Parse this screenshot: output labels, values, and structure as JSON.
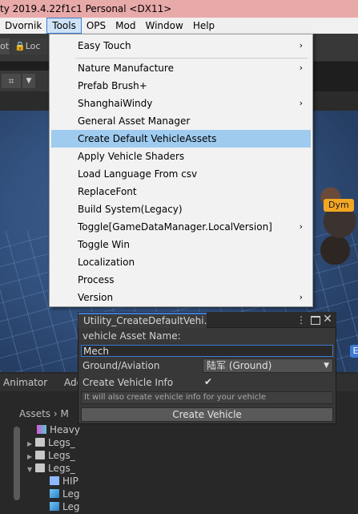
{
  "window": {
    "title": "ty 2019.4.22f1c1 Personal <DX11>"
  },
  "menubar": {
    "items": [
      "Dvornik",
      "Tools",
      "OPS",
      "Mod",
      "Window",
      "Help"
    ],
    "active": "Tools"
  },
  "scene_view": {
    "tab_left": "ot",
    "tab_lock": "Loc",
    "gizmo_icon": "grid-icon",
    "object_label_1": "Dym",
    "object_label_2": "E"
  },
  "tools_menu": {
    "items": [
      {
        "label": "Easy Touch",
        "submenu": true
      },
      {
        "label": "Nature Manufacture",
        "submenu": true
      },
      {
        "label": "Prefab Brush+",
        "submenu": false
      },
      {
        "label": "ShanghaiWindy",
        "submenu": true
      },
      {
        "label": "General Asset Manager",
        "submenu": false
      },
      {
        "label": "Create Default VehicleAssets",
        "submenu": false,
        "highlighted": true
      },
      {
        "label": "Apply Vehicle Shaders",
        "submenu": false
      },
      {
        "label": "Load Language From csv",
        "submenu": false
      },
      {
        "label": "ReplaceFont",
        "submenu": false
      },
      {
        "label": "Build System(Legacy)",
        "submenu": false
      },
      {
        "label": "Toggle[GameDataManager.LocalVersion]",
        "submenu": true
      },
      {
        "label": "Toggle Win",
        "submenu": false
      },
      {
        "label": "Localization",
        "submenu": false
      },
      {
        "label": "Process",
        "submenu": false
      },
      {
        "label": "Version",
        "submenu": true
      }
    ],
    "submenu_glyph": "›"
  },
  "utility_window": {
    "tab_title": "Utility_CreateDefaultVehi...",
    "asset_name_label": "vehicle Asset Name:",
    "asset_name_value": "Mech",
    "ground_label": "Ground/Aviation",
    "ground_value": "陆军 (Ground)",
    "create_info_label": "Create Vehicle Info",
    "create_info_checked": true,
    "check_glyph": "✔",
    "help_text": "It will also create vehicle info for your vehicle",
    "create_button": "Create Vehicle",
    "kebab_glyph": "⋮",
    "close_glyph": "✕"
  },
  "bottom_panel": {
    "tab_animator": "Animator",
    "tab_add": "Add",
    "breadcrumb": "Assets › M",
    "tree": [
      {
        "label": "Heavy",
        "icon": "heavy-icon",
        "expanded": null
      },
      {
        "label": "Legs_",
        "icon": "folder-icon",
        "expanded": false
      },
      {
        "label": "Legs_",
        "icon": "folder-icon",
        "expanded": false
      },
      {
        "label": "Legs_",
        "icon": "folder-icon",
        "expanded": true
      },
      {
        "label": "HIP",
        "icon": "prefab-icon",
        "expanded": null
      },
      {
        "label": "Leg",
        "icon": "model-icon",
        "expanded": null
      },
      {
        "label": "Leg",
        "icon": "model-icon",
        "expanded": null
      }
    ]
  }
}
